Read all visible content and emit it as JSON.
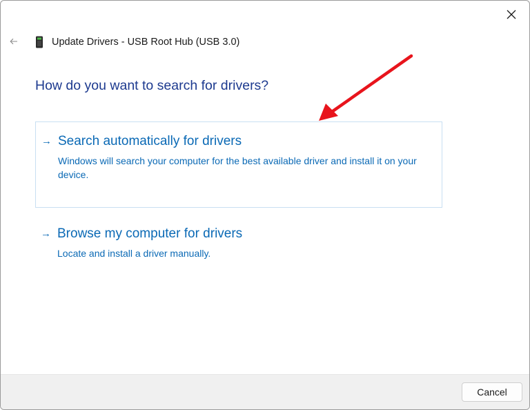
{
  "window": {
    "title": "Update Drivers - USB Root Hub (USB 3.0)",
    "close_icon": "close-icon",
    "back_icon": "back-arrow-icon",
    "device_icon": "usb-device-icon"
  },
  "main": {
    "heading": "How do you want to search for drivers?",
    "options": [
      {
        "title": "Search automatically for drivers",
        "description": "Windows will search your computer for the best available driver and install it on your device.",
        "arrow": "→",
        "highlighted": true
      },
      {
        "title": "Browse my computer for drivers",
        "description": "Locate and install a driver manually.",
        "arrow": "→",
        "highlighted": false
      }
    ]
  },
  "footer": {
    "cancel_label": "Cancel"
  },
  "colors": {
    "link_blue": "#0a69b5",
    "heading_blue": "#1d3a8f",
    "annotation_red": "#e8141c"
  }
}
